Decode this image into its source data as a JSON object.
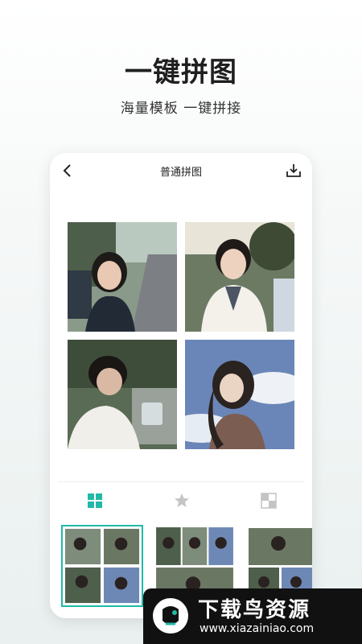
{
  "promo": {
    "title": "一键拼图",
    "subtitle": "海量模板 一键拼接"
  },
  "screen": {
    "title": "普通拼图",
    "back_icon": "chevron-left-icon",
    "download_icon": "download-icon"
  },
  "tabs": [
    {
      "icon": "grid-layout-icon",
      "active": true
    },
    {
      "icon": "sticker-star-icon",
      "active": false
    },
    {
      "icon": "border-checker-icon",
      "active": false
    }
  ],
  "colors": {
    "accent": "#22b8a7",
    "inactive_icon": "#c4c4c4"
  },
  "watermark": {
    "title": "下载鸟资源",
    "url": "www.xiazainiao.com"
  }
}
